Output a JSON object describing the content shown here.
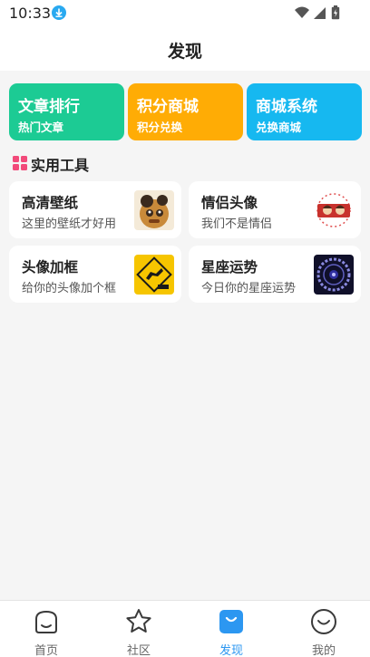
{
  "status_bar": {
    "time": "10:33",
    "icons": [
      "download-icon",
      "wifi-icon",
      "signal-icon",
      "battery-icon"
    ]
  },
  "header": {
    "title": "发现"
  },
  "feature_cards": [
    {
      "title": "文章排行",
      "subtitle": "热门文章",
      "color": "#1ccb94"
    },
    {
      "title": "积分商城",
      "subtitle": "积分兑换",
      "color": "#ffac05"
    },
    {
      "title": "商城系统",
      "subtitle": "兑换商城",
      "color": "#16b8f0"
    }
  ],
  "tools_section": {
    "title": "实用工具",
    "items": [
      {
        "title": "高清壁纸",
        "subtitle": "这里的壁纸才好用"
      },
      {
        "title": "情侣头像",
        "subtitle": "我们不是情侣"
      },
      {
        "title": "头像加框",
        "subtitle": "给你的头像加个框"
      },
      {
        "title": "星座运势",
        "subtitle": "今日你的星座运势"
      }
    ]
  },
  "tab_bar": {
    "active_color": "#2c97f1",
    "tabs": [
      {
        "label": "首页",
        "icon": "home-icon",
        "active": false
      },
      {
        "label": "社区",
        "icon": "star-icon",
        "active": false
      },
      {
        "label": "发现",
        "icon": "discover-icon",
        "active": true
      },
      {
        "label": "我的",
        "icon": "smile-icon",
        "active": false
      }
    ]
  }
}
